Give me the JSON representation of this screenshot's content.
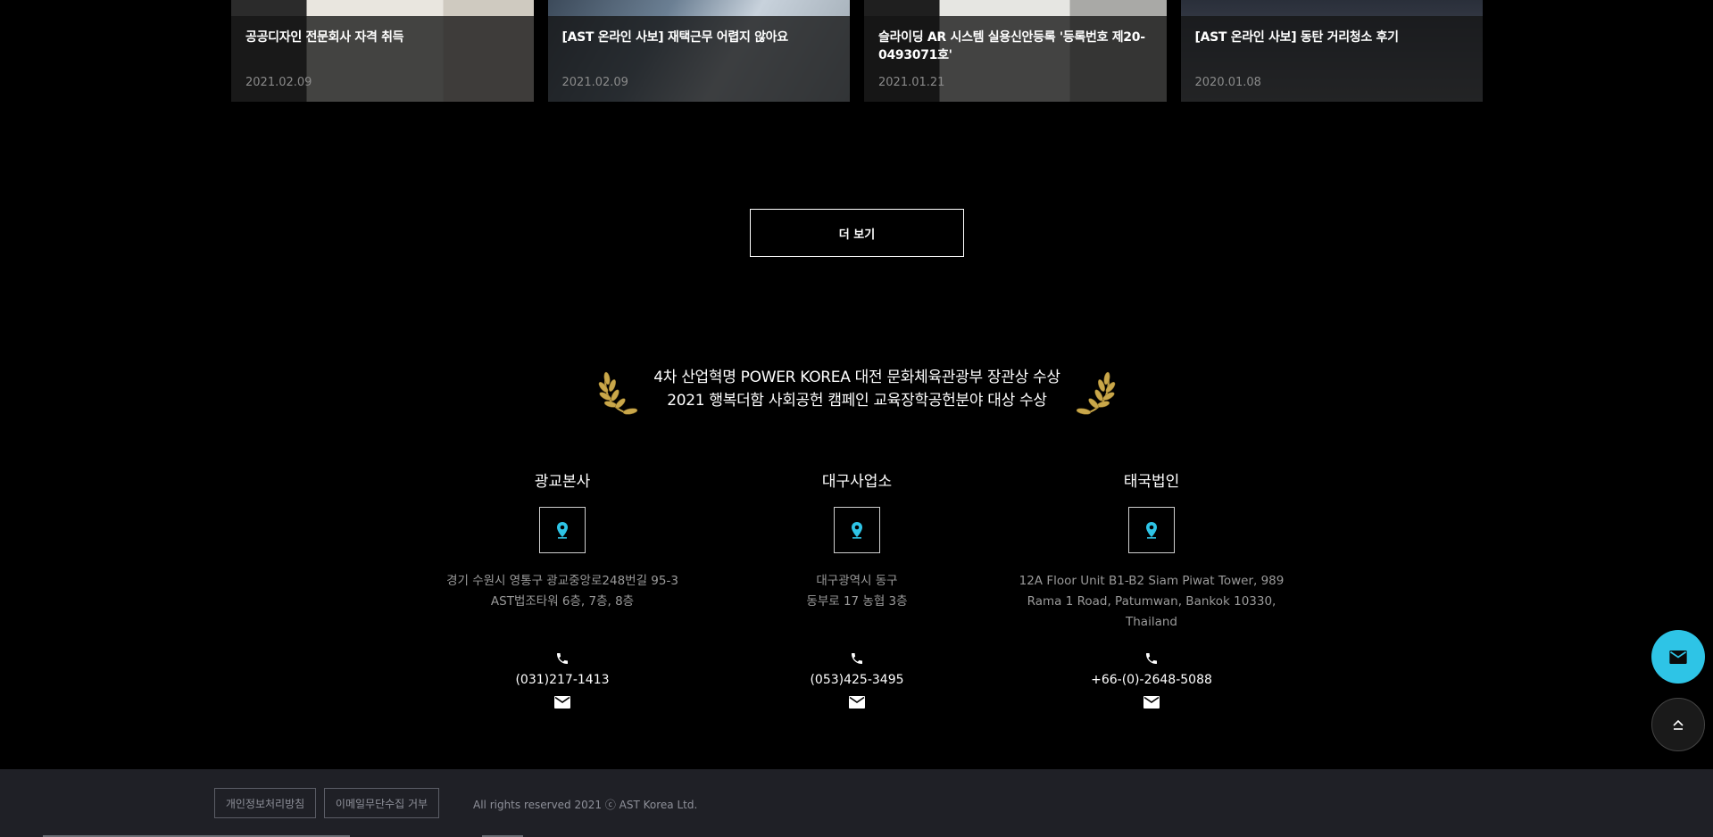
{
  "news_cards": [
    {
      "title": "공공디자인 전문회사 자격 취득",
      "date": "2021.02.09"
    },
    {
      "title": "[AST 온라인 사보] 재택근무 어렵지 않아요",
      "date": "2021.02.09"
    },
    {
      "title": "슬라이딩 AR 시스템 실용신안등록 '등록번호 제20-0493071호'",
      "date": "2021.01.21"
    },
    {
      "title": "[AST 온라인 사보] 동탄 거리청소 후기",
      "date": "2020.01.08"
    }
  ],
  "more_button": {
    "label": "더 보기"
  },
  "awards": {
    "line1": "4차 산업혁명 POWER KOREA 대전 문화체육관광부 장관상 수상",
    "line2": "2021 행복더함 사회공헌 캠페인 교육장학공헌분야 대상 수상",
    "laurel_color": "#c9a74a"
  },
  "offices": [
    {
      "name": "광교본사",
      "address": "경기 수원시 영통구 광교중앙로248번길 95-3\nAST법조타워 6층, 7층, 8층",
      "phone": "(031)217-1413"
    },
    {
      "name": "대구사업소",
      "address": "대구광역시 동구\n동부로 17 농협 3층",
      "phone": "(053)425-3495"
    },
    {
      "name": "태국법인",
      "address": "12A Floor Unit B1-B2 Siam Piwat Tower, 989\nRama 1 Road, Patumwan, Bankok 10330,\nThailand",
      "phone": "+66-(0)-2648-5088"
    }
  ],
  "icons": {
    "pin": "map-pin-icon",
    "phone": "phone-icon",
    "mail": "mail-icon",
    "top": "chevron-up-icon",
    "accent_color": "#2ec4e6"
  },
  "footer": {
    "privacy_label": "개인정보처리방침",
    "email_refuse_label": "이메일무단수집 거부",
    "copyright": "All rights reserved 2021 ⓒ AST Korea Ltd."
  }
}
